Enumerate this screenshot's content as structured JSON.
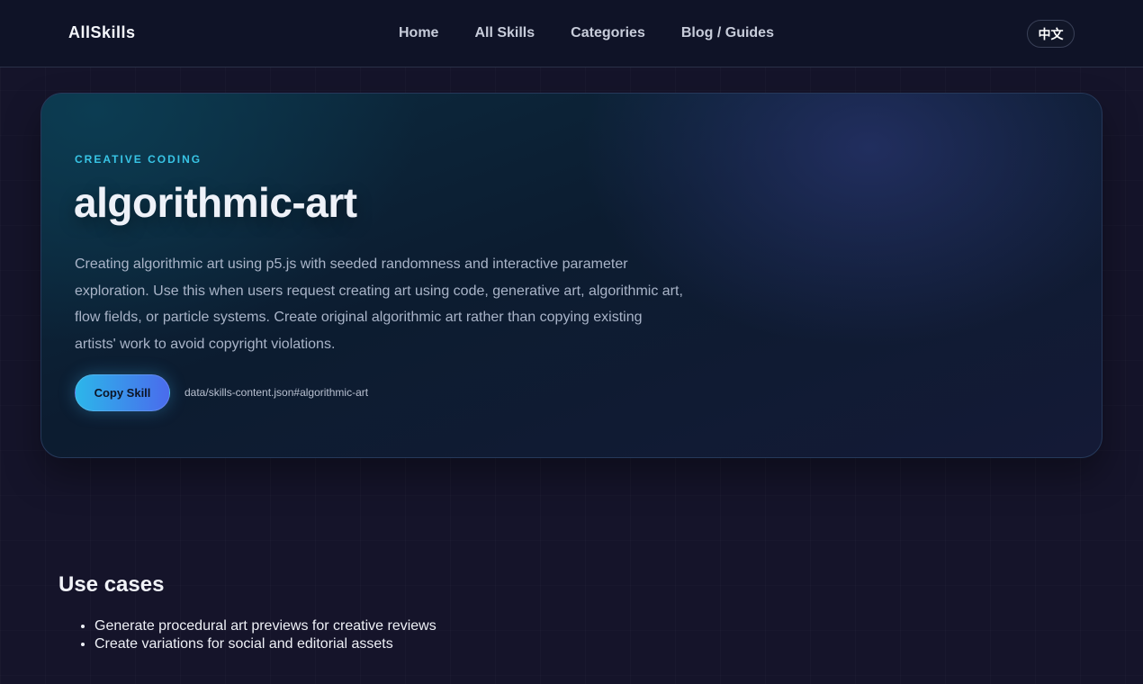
{
  "header": {
    "brand": "AllSkills",
    "nav": [
      {
        "label": "Home"
      },
      {
        "label": "All Skills"
      },
      {
        "label": "Categories"
      },
      {
        "label": "Blog / Guides"
      }
    ],
    "language_toggle": "中文"
  },
  "hero": {
    "category": "CREATIVE CODING",
    "title": "algorithmic-art",
    "description": "Creating algorithmic art using p5.js with seeded randomness and interactive parameter exploration. Use this when users request creating art using code, generative art, algorithmic art, flow fields, or particle systems. Create original algorithmic art rather than copying existing artists' work to avoid copyright violations.",
    "copy_button": "Copy Skill",
    "source_path": "data/skills-content.json#algorithmic-art"
  },
  "use_cases": {
    "heading": "Use cases",
    "items": [
      "Generate procedural art previews for creative reviews",
      "Create variations for social and editorial assets"
    ]
  },
  "colors": {
    "accent_cyan": "#38c5e6",
    "button_gradient_start": "#2cb6ea",
    "button_gradient_end": "#4a6bec",
    "page_background": "#15142a",
    "header_background": "#0f1327"
  }
}
